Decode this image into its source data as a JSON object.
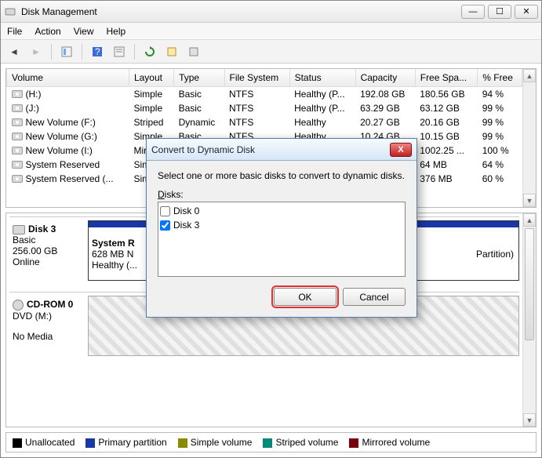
{
  "window": {
    "title": "Disk Management"
  },
  "menubar": [
    "File",
    "Action",
    "View",
    "Help"
  ],
  "table": {
    "headers": [
      "Volume",
      "Layout",
      "Type",
      "File System",
      "Status",
      "Capacity",
      "Free Spa...",
      "% Free"
    ],
    "rows": [
      {
        "vol": "(H:)",
        "layout": "Simple",
        "type": "Basic",
        "fs": "NTFS",
        "status": "Healthy (P...",
        "cap": "192.08 GB",
        "free": "180.56 GB",
        "pct": "94 %"
      },
      {
        "vol": "(J:)",
        "layout": "Simple",
        "type": "Basic",
        "fs": "NTFS",
        "status": "Healthy (P...",
        "cap": "63.29 GB",
        "free": "63.12 GB",
        "pct": "99 %"
      },
      {
        "vol": "New Volume (F:)",
        "layout": "Striped",
        "type": "Dynamic",
        "fs": "NTFS",
        "status": "Healthy",
        "cap": "20.27 GB",
        "free": "20.16 GB",
        "pct": "99 %"
      },
      {
        "vol": "New Volume (G:)",
        "layout": "Simple",
        "type": "Basic",
        "fs": "NTFS",
        "status": "Healthy",
        "cap": "10.24 GB",
        "free": "10.15 GB",
        "pct": "99 %"
      },
      {
        "vol": "New Volume (I:)",
        "layout": "Mirro...",
        "type": "",
        "fs": "",
        "status": "",
        "cap": "",
        "free": "1002.25 ...",
        "pct": "100 %"
      },
      {
        "vol": "System Reserved",
        "layout": "Simpl...",
        "type": "",
        "fs": "",
        "status": "",
        "cap": "",
        "free": "64 MB",
        "pct": "64 %"
      },
      {
        "vol": "System Reserved (...",
        "layout": "Simpl...",
        "type": "",
        "fs": "",
        "status": "",
        "cap": "",
        "free": "376 MB",
        "pct": "60 %"
      }
    ]
  },
  "disks": {
    "d3": {
      "name": "Disk 3",
      "kind": "Basic",
      "size": "256.00 GB",
      "state": "Online",
      "p1": {
        "title": "System R",
        "size": "628 MB N",
        "status": "Healthy (..."
      },
      "p2tail": "Partition)"
    },
    "cd": {
      "name": "CD-ROM 0",
      "kind": "DVD (M:)",
      "state": "No Media"
    }
  },
  "legend": [
    "Unallocated",
    "Primary partition",
    "Simple volume",
    "Striped volume",
    "Mirrored volume"
  ],
  "dialog": {
    "title": "Convert to Dynamic Disk",
    "instr": "Select one or more basic disks to convert to dynamic disks.",
    "disks_label": "Disks:",
    "items": [
      {
        "label": "Disk 0",
        "checked": false
      },
      {
        "label": "Disk 3",
        "checked": true
      }
    ],
    "ok": "OK",
    "cancel": "Cancel"
  }
}
